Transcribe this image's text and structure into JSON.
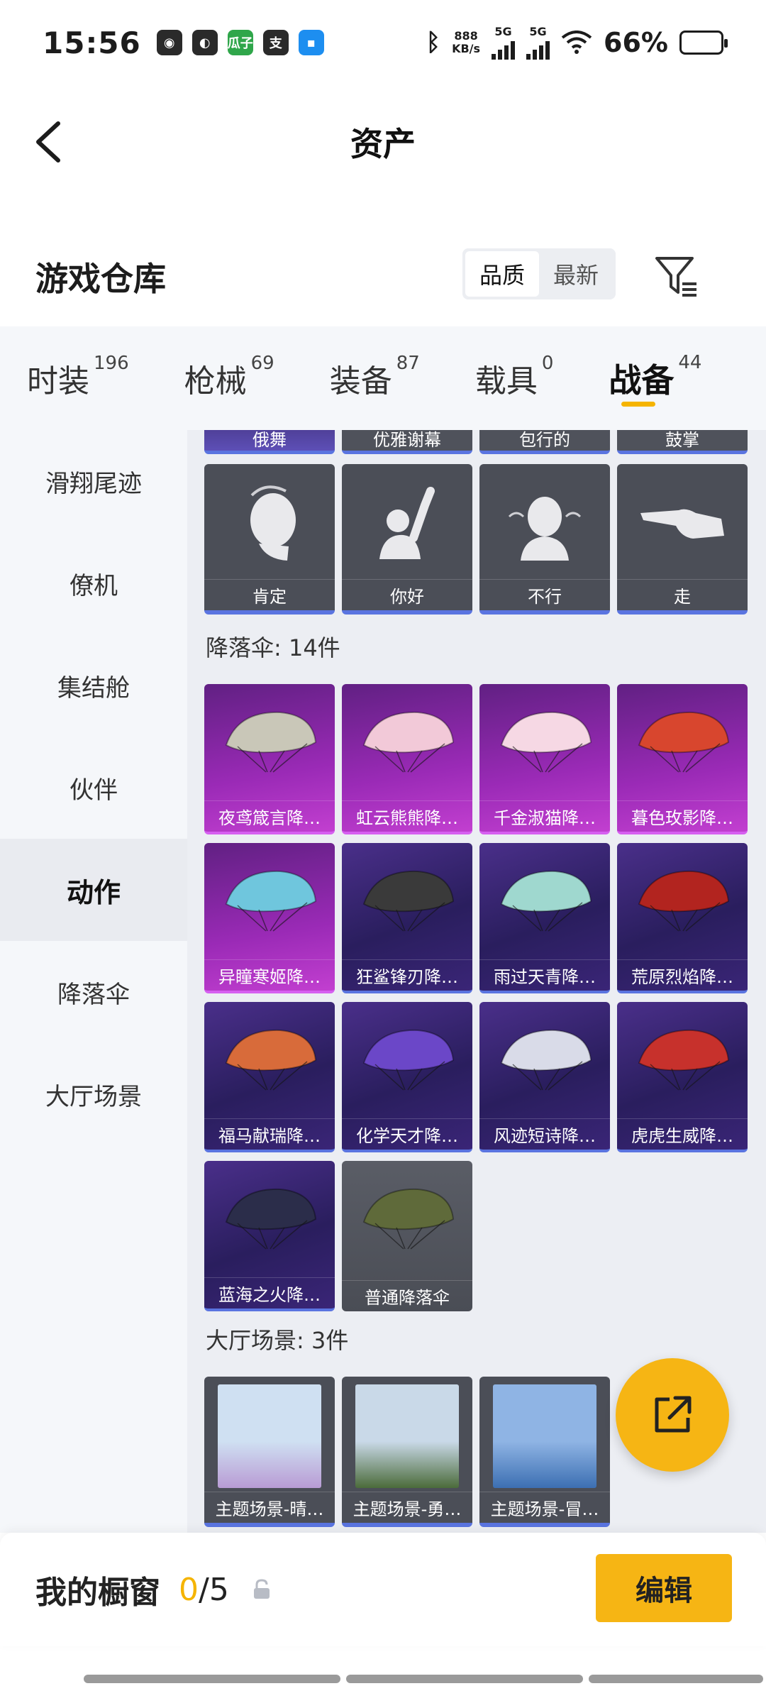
{
  "status": {
    "time": "15:56",
    "apps": [
      "wechat-icon",
      "browser-icon",
      "瓜子",
      "支",
      "chat-icon"
    ],
    "net_speed_top": "888",
    "net_speed_unit": "KB/s",
    "sim1": "5G",
    "sim2": "5G",
    "battery": "66%",
    "battery_level": 0.66
  },
  "header": {
    "title": "资产"
  },
  "warehouse": {
    "title": "游戏仓库",
    "sort_options": [
      "品质",
      "最新"
    ],
    "active_sort": "品质"
  },
  "categories": [
    {
      "name": "时装",
      "count": "196"
    },
    {
      "name": "枪械",
      "count": "69"
    },
    {
      "name": "装备",
      "count": "87"
    },
    {
      "name": "载具",
      "count": "0"
    },
    {
      "name": "战备",
      "count": "44",
      "active": true
    }
  ],
  "sidebar": {
    "items": [
      {
        "label": "滑翔尾迹"
      },
      {
        "label": "僚机"
      },
      {
        "label": "集结舱"
      },
      {
        "label": "伙伴"
      },
      {
        "label": "动作",
        "active": true
      },
      {
        "label": "降落伞"
      },
      {
        "label": "大厅场景"
      }
    ]
  },
  "content": {
    "partial_row": [
      "俄舞",
      "优雅谢幕",
      "包行的",
      "鼓掌"
    ],
    "actions": [
      {
        "label": "肯定",
        "icon": "nod-gesture-icon"
      },
      {
        "label": "你好",
        "icon": "wave-gesture-icon"
      },
      {
        "label": "不行",
        "icon": "shake-head-icon"
      },
      {
        "label": "走",
        "icon": "point-hand-icon"
      }
    ],
    "parachute_section": "降落伞: 14件",
    "parachutes": [
      {
        "label": "夜鸢箴言降…",
        "rarity": "pink",
        "color": "#c9c7b8"
      },
      {
        "label": "虹云熊熊降…",
        "rarity": "pink",
        "color": "#f2c9d8"
      },
      {
        "label": "千金淑猫降…",
        "rarity": "pink",
        "color": "#f6d8e4"
      },
      {
        "label": "暮色玫影降…",
        "rarity": "pink",
        "color": "#d8462e"
      },
      {
        "label": "异瞳寒姬降…",
        "rarity": "pink",
        "color": "#6fc6dd"
      },
      {
        "label": "狂鲨锋刃降…",
        "rarity": "purple",
        "color": "#3a3a3a"
      },
      {
        "label": "雨过天青降…",
        "rarity": "purple",
        "color": "#9fd8cf"
      },
      {
        "label": "荒原烈焰降…",
        "rarity": "purple",
        "color": "#b2241f"
      },
      {
        "label": "福马献瑞降…",
        "rarity": "purple",
        "color": "#d86b3a"
      },
      {
        "label": "化学天才降…",
        "rarity": "purple",
        "color": "#6b47c8"
      },
      {
        "label": "风迹短诗降…",
        "rarity": "purple",
        "color": "#d9dbe8"
      },
      {
        "label": "虎虎生威降…",
        "rarity": "purple",
        "color": "#c7312c"
      },
      {
        "label": "蓝海之火降…",
        "rarity": "purple",
        "color": "#2b2d4a"
      },
      {
        "label": "普通降落伞",
        "rarity": "gray",
        "color": "#5f6a3a"
      }
    ],
    "scene_section": "大厅场景: 3件",
    "scenes": [
      {
        "label": "主题场景-晴…",
        "sky": "#cfe0f2",
        "ground": "#b89bd4"
      },
      {
        "label": "主题场景-勇…",
        "sky": "#c9d9e8",
        "ground": "#4b6b3a"
      },
      {
        "label": "主题场景-冒…",
        "sky": "#8fb4e4",
        "ground": "#3c6fb2"
      }
    ]
  },
  "bottom": {
    "showcase_label": "我的橱窗",
    "used": "0",
    "total": "/5",
    "edit_label": "编辑"
  }
}
